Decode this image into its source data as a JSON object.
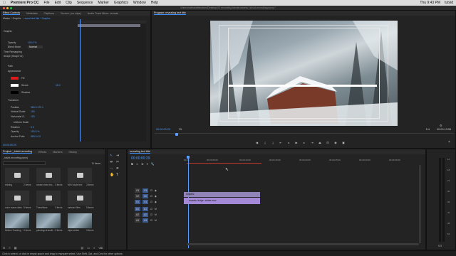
{
  "menubar": {
    "apple": "",
    "app": "Premiere Pro CC",
    "items": [
      "File",
      "Edit",
      "Clip",
      "Sequence",
      "Marker",
      "Graphics",
      "Window",
      "Help"
    ],
    "right": [
      "Thu 9:43 PM",
      "tutvid"
    ]
  },
  "window_title": "/Users/nathanielteodoro/Desktop/03 recording-tutorial-assets/_tutvid-recording.prproj *",
  "effect_controls": {
    "tabs": [
      "Effect Controls",
      "Metadata",
      "Captions",
      "Source: (no clips)",
      "Audio Track Mixer: reveals"
    ],
    "source": "Master * Graphic",
    "clip": "reveal text title * Graphic",
    "rows": [
      {
        "label": "Graphic",
        "value": ""
      },
      {
        "label": "Opacity",
        "value": "100.0 %"
      },
      {
        "label": "Blend Mode",
        "value": "Normal"
      },
      {
        "label": "Time Remapping",
        "value": ""
      },
      {
        "label": "Shape (Shape 01)",
        "value": ""
      },
      {
        "label": "Path",
        "value": ""
      },
      {
        "label": "Appearance",
        "value": ""
      },
      {
        "label": "Fill",
        "value": ""
      },
      {
        "label": "Stroke",
        "value": "15.0"
      },
      {
        "label": "Shadow",
        "value": ""
      },
      {
        "label": "Transform",
        "value": ""
      },
      {
        "label": "Position",
        "value": "960.0  479.1"
      },
      {
        "label": "Vertical Scale",
        "value": "100"
      },
      {
        "label": "Horizontal S...",
        "value": "100"
      },
      {
        "label": "Uniform Scale",
        "value": ""
      },
      {
        "label": "Rotation",
        "value": "0.0"
      },
      {
        "label": "Opacity",
        "value": "100.0 %"
      },
      {
        "label": "Anchor Point",
        "value": "960.0  0.0"
      }
    ],
    "timecode": "00:00:00:29"
  },
  "program": {
    "title": "Program: revealing text title",
    "timecode": "00:00:00:29",
    "fit": "Fit",
    "fraction": "1/4",
    "duration": "00:00:13:08"
  },
  "project": {
    "tabs": [
      "Project: _tutvid-recording",
      "Effects",
      "Markers",
      "History"
    ],
    "path": "_tutvid-recording.prproj",
    "count": "11 Items",
    "bins": [
      {
        "name": "shining",
        "count": "2 Items",
        "row": 0,
        "col": 0
      },
      {
        "name": "create video tex...",
        "count": "3 Items",
        "row": 0,
        "col": 1
      },
      {
        "name": "MKV style text",
        "count": "3 Items",
        "row": 0,
        "col": 2
      },
      {
        "name": "color mass video",
        "count": "5 Items",
        "row": 1,
        "col": 0
      },
      {
        "name": "Transitions",
        "count": "3 Items",
        "row": 1,
        "col": 1
      },
      {
        "name": "salmon titles",
        "count": "5 Items",
        "row": 1,
        "col": 2
      },
      {
        "name": "Motion Tracking",
        "count": "4 Items",
        "row": 2,
        "col": 0
      },
      {
        "name": "paintings transiti...",
        "count": "3 Items",
        "row": 2,
        "col": 1
      },
      {
        "name": "triple slides",
        "count": "3 Items",
        "row": 2,
        "col": 2
      }
    ]
  },
  "timeline": {
    "tab": "revealing text title",
    "timecode": "00:00:00:29",
    "ruler": [
      "00:00",
      "00:00:05:00",
      "00:00:10:00",
      "00:00:15:00",
      "00:00:20:00",
      "00:00:25:00",
      "00:00:30:00",
      "00:00:35:00"
    ],
    "tracks": [
      "V3",
      "V2",
      "V1",
      "A1",
      "A2",
      "A3"
    ],
    "clips": [
      {
        "name": "Graphic",
        "track": "V2"
      },
      {
        "name": "reveals: fudge -winter.mov",
        "track": "V1"
      }
    ]
  },
  "meters": {
    "labels": [
      "-12",
      "-18",
      "-24",
      "-30",
      "-36",
      "-42",
      "-48",
      "-54"
    ],
    "footer": "S S"
  },
  "status": "Click to select, or click in empty space and drag to marquee select. Use Shift, Opt, and Cmd for other options.",
  "colors": {
    "accent": "#3d8eff",
    "clip_video": "#a48ad6",
    "clip_graphic": "#8f83b8",
    "fill_swatch": "#e01a1a",
    "playhead": "#5b9cff"
  }
}
